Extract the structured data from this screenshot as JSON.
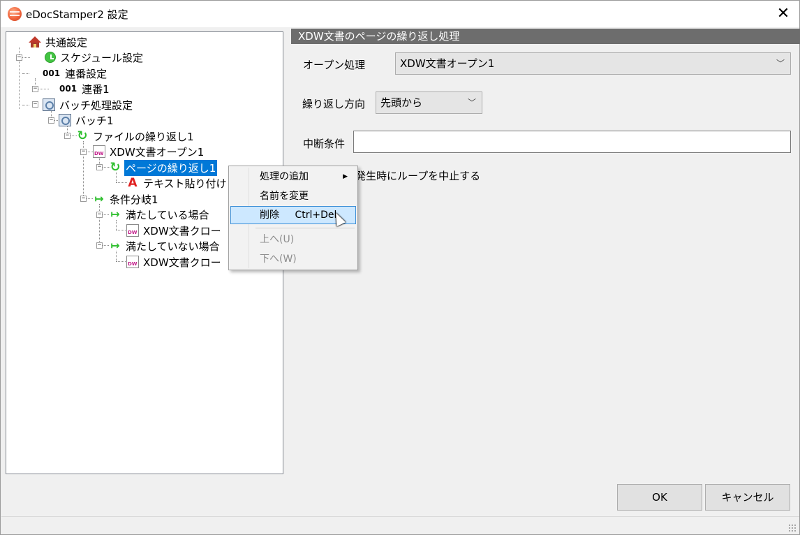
{
  "window": {
    "title": "eDocStamper2 設定",
    "close_glyph": "✕"
  },
  "tree": {
    "items": [
      {
        "label": "共通設定",
        "icon": "house-icon"
      },
      {
        "label": "スケジュール設定",
        "icon": "clock-icon"
      },
      {
        "label": "連番設定",
        "icon_text": "001"
      },
      {
        "label": "連番1",
        "icon_text": "001"
      },
      {
        "label": "バッチ処理設定",
        "icon": "batch-icon"
      },
      {
        "label": "バッチ1",
        "icon": "batch-icon"
      },
      {
        "label": "ファイルの繰り返し1",
        "icon": "loop-icon"
      },
      {
        "label": "XDW文書オープン1",
        "icon": "docuworks-icon"
      },
      {
        "label": "ページの繰り返し1",
        "icon": "loop-icon",
        "selected": true
      },
      {
        "label": "テキスト貼り付け",
        "icon": "text-stamp-icon"
      },
      {
        "label": "条件分岐1",
        "icon": "branch-icon"
      },
      {
        "label": "満たしている場合",
        "icon": "branch-icon"
      },
      {
        "label": "XDW文書クロー",
        "icon": "docuworks-icon"
      },
      {
        "label": "満たしていない場合",
        "icon": "branch-icon"
      },
      {
        "label": "XDW文書クロー",
        "icon": "docuworks-icon"
      }
    ]
  },
  "panel": {
    "header": "XDW文書のページの繰り返し処理",
    "open_label": "オープン処理",
    "open_value": "XDW文書オープン1",
    "direction_label": "繰り返し方向",
    "direction_value": "先頭から",
    "break_label": "中断条件",
    "break_value": "",
    "stop_on_error_label": "発生時にループを中止する"
  },
  "context_menu": {
    "items": [
      {
        "label": "処理の追加",
        "submenu": true
      },
      {
        "label": "名前を変更"
      },
      {
        "label": "削除",
        "shortcut": "Ctrl+Del",
        "highlighted": true
      },
      {
        "label": "上へ(U)",
        "disabled": true
      },
      {
        "label": "下へ(W)",
        "disabled": true
      }
    ]
  },
  "buttons": {
    "ok": "OK",
    "cancel": "キャンセル"
  }
}
